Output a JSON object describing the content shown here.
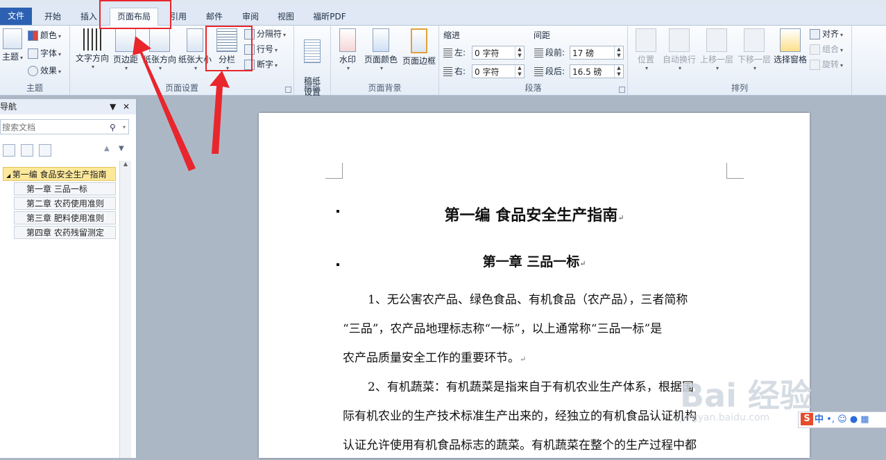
{
  "tabs": [
    {
      "label": "文件"
    },
    {
      "label": "开始"
    },
    {
      "label": "插入"
    },
    {
      "label": "页面布局"
    },
    {
      "label": "引用"
    },
    {
      "label": "邮件"
    },
    {
      "label": "审阅"
    },
    {
      "label": "视图"
    },
    {
      "label": "福昕PDF"
    }
  ],
  "ribbon": {
    "theme_group": {
      "label": "主题",
      "theme": "主题",
      "colors": "颜色",
      "fonts": "字体",
      "effects": "效果"
    },
    "page_setup_group": {
      "label": "页面设置",
      "text_direction": "文字方向",
      "margins": "页边距",
      "orientation": "纸张方向",
      "size": "纸张大小",
      "columns": "分栏",
      "breaks": "分隔符",
      "line_numbers": "行号",
      "hyphenation": "断字"
    },
    "manuscript_group": {
      "label": "稿纸",
      "settings": "稿纸\n设置"
    },
    "background_group": {
      "label": "页面背景",
      "watermark": "水印",
      "page_color": "页面颜色",
      "page_borders": "页面边框"
    },
    "paragraph_group": {
      "label": "段落",
      "indent_title": "缩进",
      "spacing_title": "间距",
      "left_label": "左:",
      "left_value": "0 字符",
      "right_label": "右:",
      "right_value": "0 字符",
      "before_label": "段前:",
      "before_value": "17 磅",
      "after_label": "段后:",
      "after_value": "16.5 磅"
    },
    "arrange_group": {
      "label": "排列",
      "position": "位置",
      "wrap": "自动换行",
      "forward": "上移一层",
      "backward": "下移一层",
      "selection_pane": "选择窗格",
      "align": "对齐",
      "group": "组合",
      "rotate": "旋转"
    }
  },
  "nav": {
    "title": "导航",
    "search_placeholder": "搜索文档",
    "selected": "第一编 食品安全生产指南",
    "items": [
      {
        "label": "第一章 三品一标"
      },
      {
        "label": "第二章 农药使用准则"
      },
      {
        "label": "第三章 肥料使用准则"
      },
      {
        "label": "第四章 农药残留测定"
      }
    ]
  },
  "document": {
    "title": "第一编  食品安全生产指南",
    "chapter": "第一章  三品一标",
    "lines": [
      "1、无公害农产品、绿色食品、有机食品（农产品），三者简称",
      "“三品”，农产品地理标志称“一标”，以上通常称“三品一标”是",
      "农产品质量安全工作的重要环节。",
      "2、有机蔬菜：有机蔬菜是指来自于有机农业生产体系，根据国",
      "际有机农业的生产技术标准生产出来的，经独立的有机食品认证机构",
      "认证允许使用有机食品标志的蔬菜。有机蔬菜在整个的生产过程中都"
    ],
    "para_mark": "↵"
  },
  "watermark": {
    "text": "Bai 经验",
    "url": "jingyan.baidu.com"
  },
  "ime": {
    "label": "中"
  },
  "colors": {
    "annotation": "#e8262c",
    "file_tab": "#2c61b2"
  }
}
